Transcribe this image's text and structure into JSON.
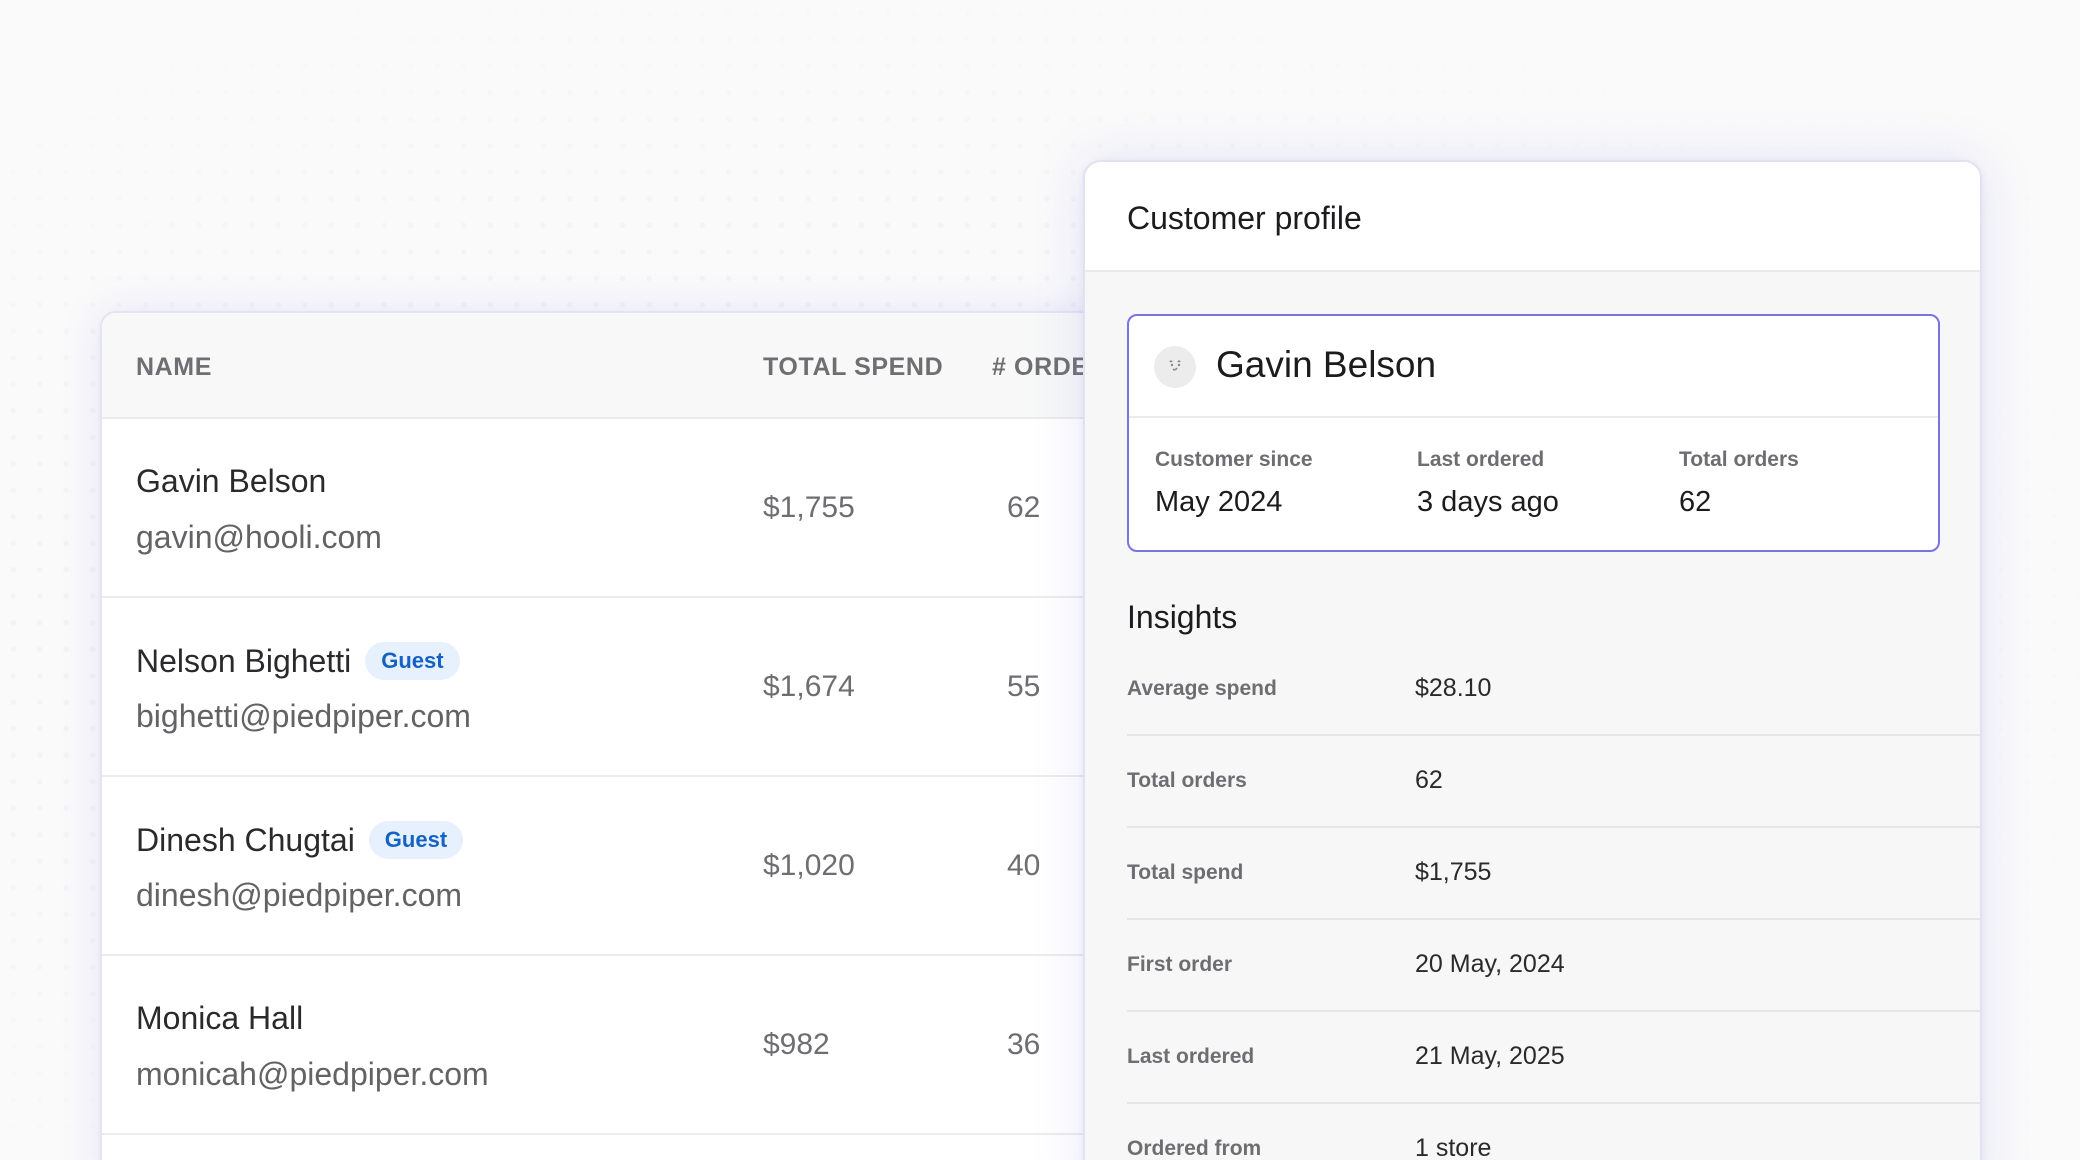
{
  "customers_table": {
    "columns": {
      "name": "NAME",
      "total_spend": "TOTAL SPEND",
      "orders": "# ORDERS"
    },
    "rows": [
      {
        "name": "Gavin Belson",
        "email": "gavin@hooli.com",
        "badge": "",
        "spend": "$1,755",
        "orders": "62"
      },
      {
        "name": "Nelson Bighetti",
        "email": "bighetti@piedpiper.com",
        "badge": "Guest",
        "spend": "$1,674",
        "orders": "55"
      },
      {
        "name": "Dinesh Chugtai",
        "email": "dinesh@piedpiper.com",
        "badge": "Guest",
        "spend": "$1,020",
        "orders": "40"
      },
      {
        "name": "Monica Hall",
        "email": "monicah@piedpiper.com",
        "badge": "",
        "spend": "$982",
        "orders": "36"
      }
    ]
  },
  "profile": {
    "title": "Customer profile",
    "avatar_icon": "face-icon",
    "name": "Gavin Belson",
    "stats": [
      {
        "label": "Customer since",
        "value": "May 2024"
      },
      {
        "label": "Last ordered",
        "value": "3 days ago"
      },
      {
        "label": "Total orders",
        "value": "62"
      }
    ],
    "insights_title": "Insights",
    "insights": [
      {
        "label": "Average spend",
        "value": "$28.10"
      },
      {
        "label": "Total orders",
        "value": "62"
      },
      {
        "label": "Total spend",
        "value": "$1,755"
      },
      {
        "label": "First order",
        "value": "20 May, 2024"
      },
      {
        "label": "Last ordered",
        "value": "21 May, 2025"
      },
      {
        "label": "Ordered from",
        "value": "1 store"
      }
    ]
  },
  "colors": {
    "accent_border": "#7a74e0",
    "guest_badge_text": "#1662c4",
    "guest_badge_bg": "#e6f1fd"
  }
}
